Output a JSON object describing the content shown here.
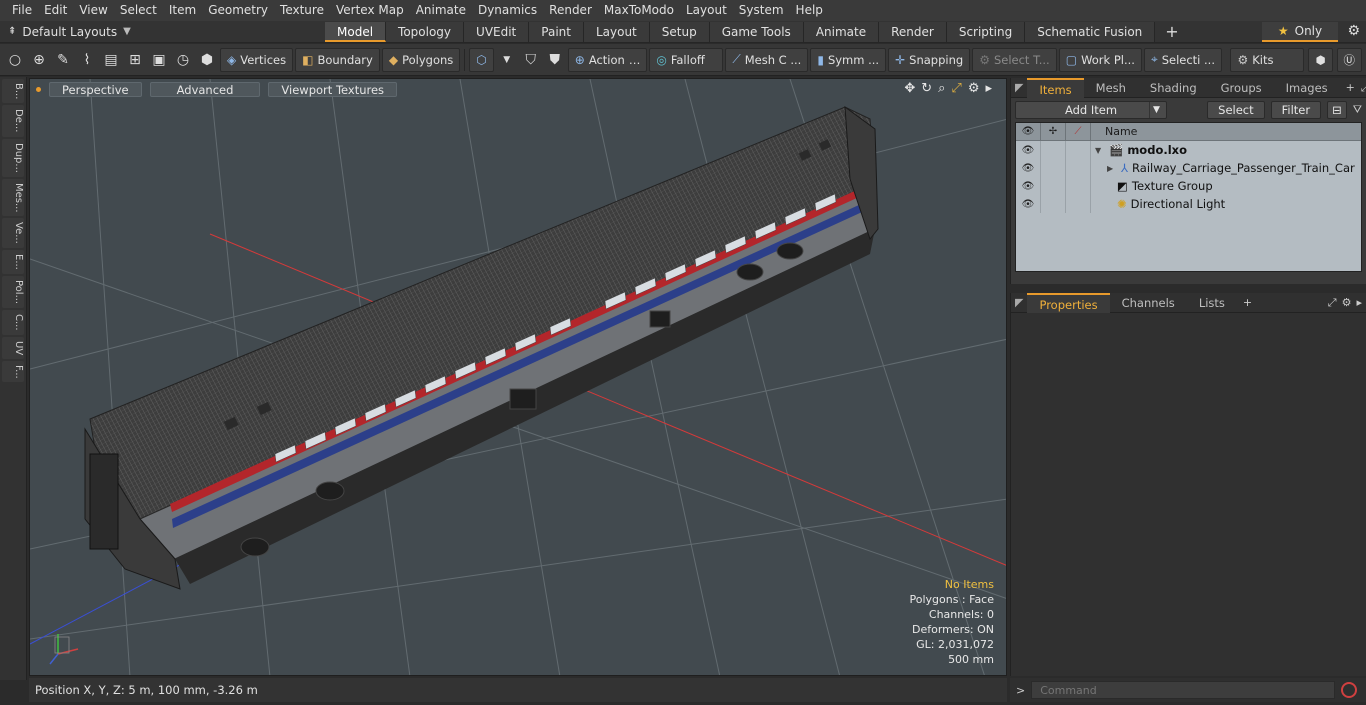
{
  "menu": [
    "File",
    "Edit",
    "View",
    "Select",
    "Item",
    "Geometry",
    "Texture",
    "Vertex Map",
    "Animate",
    "Dynamics",
    "Render",
    "MaxToModo",
    "Layout",
    "System",
    "Help"
  ],
  "layout_selector": "Default Layouts",
  "layout_tabs": [
    "Model",
    "Topology",
    "UVEdit",
    "Paint",
    "Layout",
    "Setup",
    "Game Tools",
    "Animate",
    "Render",
    "Scripting",
    "Schematic Fusion"
  ],
  "only_label": "Only",
  "toolbar": {
    "vertices": "Vertices",
    "boundary": "Boundary",
    "polygons": "Polygons",
    "action": "Action",
    "falloff": "Falloff",
    "mesh": "Mesh C ...",
    "symm": "Symm ...",
    "snapping": "Snapping",
    "select_t": "Select T...",
    "work_pl": "Work Pl...",
    "selecti": "Selecti ...",
    "kits": "Kits"
  },
  "left_tabs": [
    "B...",
    "De...",
    "Dup...",
    "Mes...",
    "Ve...",
    "E...",
    "Pol...",
    "C...",
    "UV",
    "F..."
  ],
  "viewport": {
    "view_mode": "Perspective",
    "advanced": "Advanced",
    "textures": "Viewport Textures",
    "stats": {
      "no_items": "No Items",
      "polygons": "Polygons : Face",
      "channels": "Channels: 0",
      "deformers": "Deformers: ON",
      "gl": "GL: 2,031,072",
      "scale": "500 mm"
    }
  },
  "status": {
    "position": "Position X, Y, Z:   5 m, 100 mm, -3.26 m"
  },
  "items_panel": {
    "tabs": [
      "Items",
      "Mesh ...",
      "Shading",
      "Groups",
      "Images"
    ],
    "add_item": "Add Item",
    "select": "Select",
    "filter": "Filter",
    "column_name": "Name",
    "rows": [
      {
        "name": "modo.lxo",
        "bold": true
      },
      {
        "name": "Railway_Carriage_Passenger_Train_Car"
      },
      {
        "name": "Texture Group"
      },
      {
        "name": "Directional Light"
      }
    ]
  },
  "props_panel": {
    "tabs": [
      "Properties",
      "Channels",
      "Lists"
    ]
  },
  "command": {
    "placeholder": "Command"
  }
}
